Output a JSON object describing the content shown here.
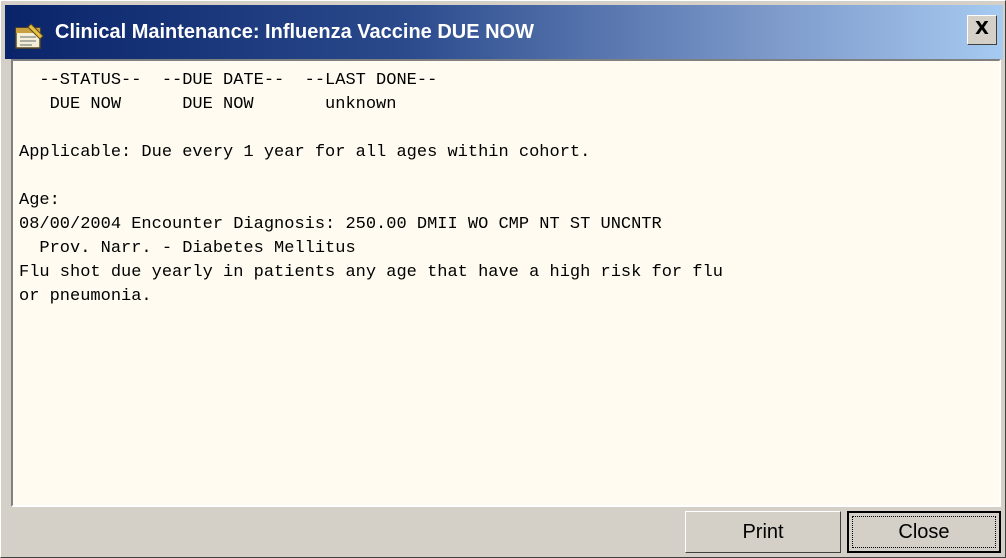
{
  "window": {
    "title": "Clinical Maintenance: Influenza Vaccine  DUE NOW",
    "close_glyph": "X",
    "icon": "notepad-icon"
  },
  "report": {
    "header_line": "  --STATUS--  --DUE DATE--  --LAST DONE--",
    "values_line": "   DUE NOW      DUE NOW       unknown",
    "applicable": "Applicable: Due every 1 year for all ages within cohort.",
    "age_label": "Age:",
    "encounter_line": "08/00/2004 Encounter Diagnosis: 250.00 DMII WO CMP NT ST UNCNTR",
    "narrative_line": "  Prov. Narr. - Diabetes Mellitus",
    "note_line_1": "Flu shot due yearly in patients any age that have a high risk for flu",
    "note_line_2": "or pneumonia."
  },
  "buttons": {
    "print": "Print",
    "close": "Close"
  },
  "colors": {
    "content_background": "#fffbf0",
    "titlebar_start": "#0a246a",
    "titlebar_end": "#a6caf0"
  }
}
